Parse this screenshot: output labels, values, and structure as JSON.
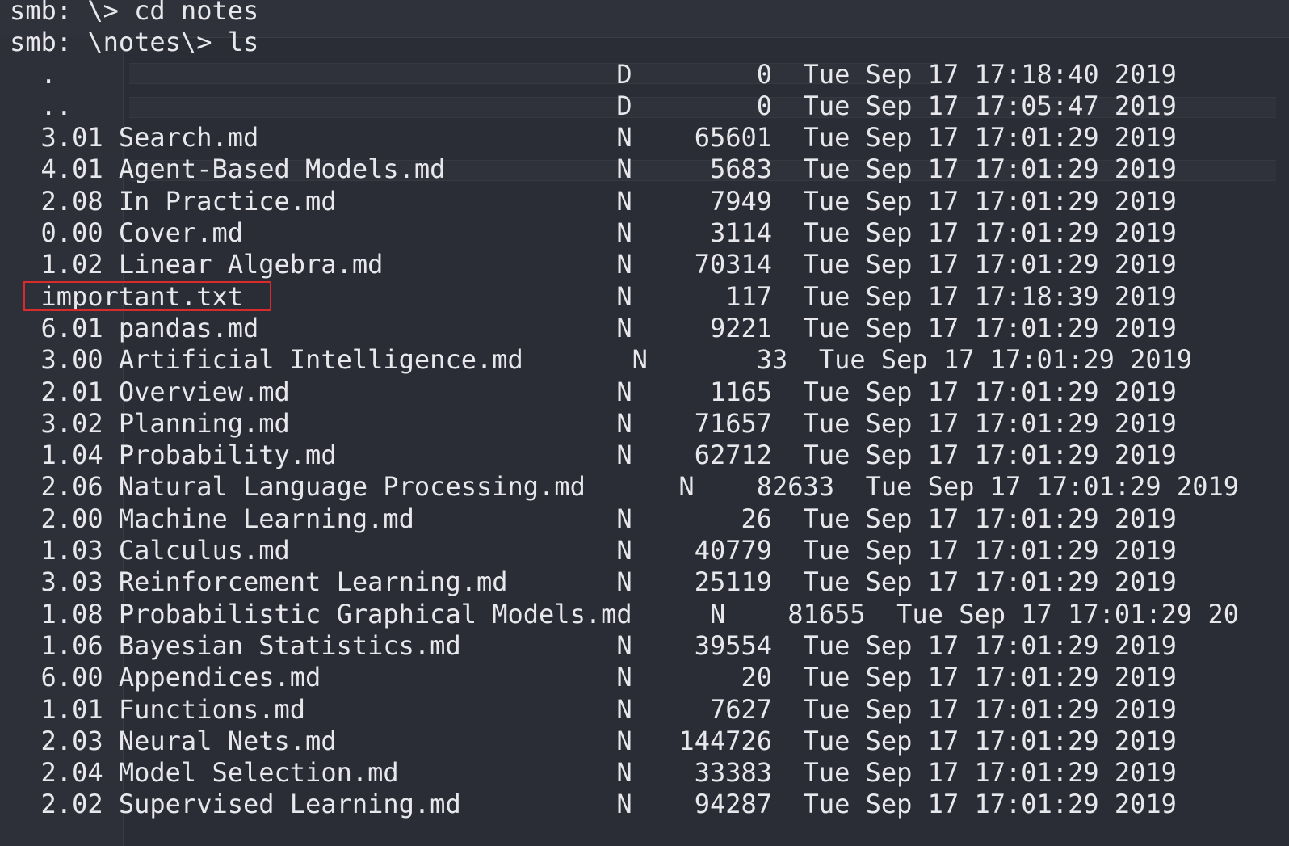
{
  "terminal": {
    "prompt_lines": [
      "smb: \\> cd notes",
      "smb: \\notes\\> ls"
    ],
    "highlight_color": "#d92b2b",
    "text_color": "#e8e8ec",
    "background_color": "#2b2d36",
    "listing": [
      "  .                                    D        0  Tue Sep 17 17:18:40 2019",
      "  ..                                   D        0  Tue Sep 17 17:05:47 2019",
      "  3.01 Search.md                       N    65601  Tue Sep 17 17:01:29 2019",
      "  4.01 Agent-Based Models.md           N     5683  Tue Sep 17 17:01:29 2019",
      "  2.08 In Practice.md                  N     7949  Tue Sep 17 17:01:29 2019",
      "  0.00 Cover.md                        N     3114  Tue Sep 17 17:01:29 2019",
      "  1.02 Linear Algebra.md               N    70314  Tue Sep 17 17:01:29 2019",
      "  important.txt                        N      117  Tue Sep 17 17:18:39 2019",
      "  6.01 pandas.md                       N     9221  Tue Sep 17 17:01:29 2019",
      "  3.00 Artificial Intelligence.md       N       33  Tue Sep 17 17:01:29 2019",
      "  2.01 Overview.md                     N     1165  Tue Sep 17 17:01:29 2019",
      "  3.02 Planning.md                     N    71657  Tue Sep 17 17:01:29 2019",
      "  1.04 Probability.md                  N    62712  Tue Sep 17 17:01:29 2019",
      "  2.06 Natural Language Processing.md      N    82633  Tue Sep 17 17:01:29 2019",
      "  2.00 Machine Learning.md             N       26  Tue Sep 17 17:01:29 2019",
      "  1.03 Calculus.md                     N    40779  Tue Sep 17 17:01:29 2019",
      "  3.03 Reinforcement Learning.md       N    25119  Tue Sep 17 17:01:29 2019",
      "  1.08 Probabilistic Graphical Models.md     N    81655  Tue Sep 17 17:01:29 20",
      "  1.06 Bayesian Statistics.md          N    39554  Tue Sep 17 17:01:29 2019",
      "  6.00 Appendices.md                   N       20  Tue Sep 17 17:01:29 2019",
      "  1.01 Functions.md                    N     7627  Tue Sep 17 17:01:29 2019",
      "  2.03 Neural Nets.md                  N   144726  Tue Sep 17 17:01:29 2019",
      "  2.04 Model Selection.md              N    33383  Tue Sep 17 17:01:29 2019",
      "  2.02 Supervised Learning.md          N    94287  Tue Sep 17 17:01:29 2019"
    ]
  }
}
